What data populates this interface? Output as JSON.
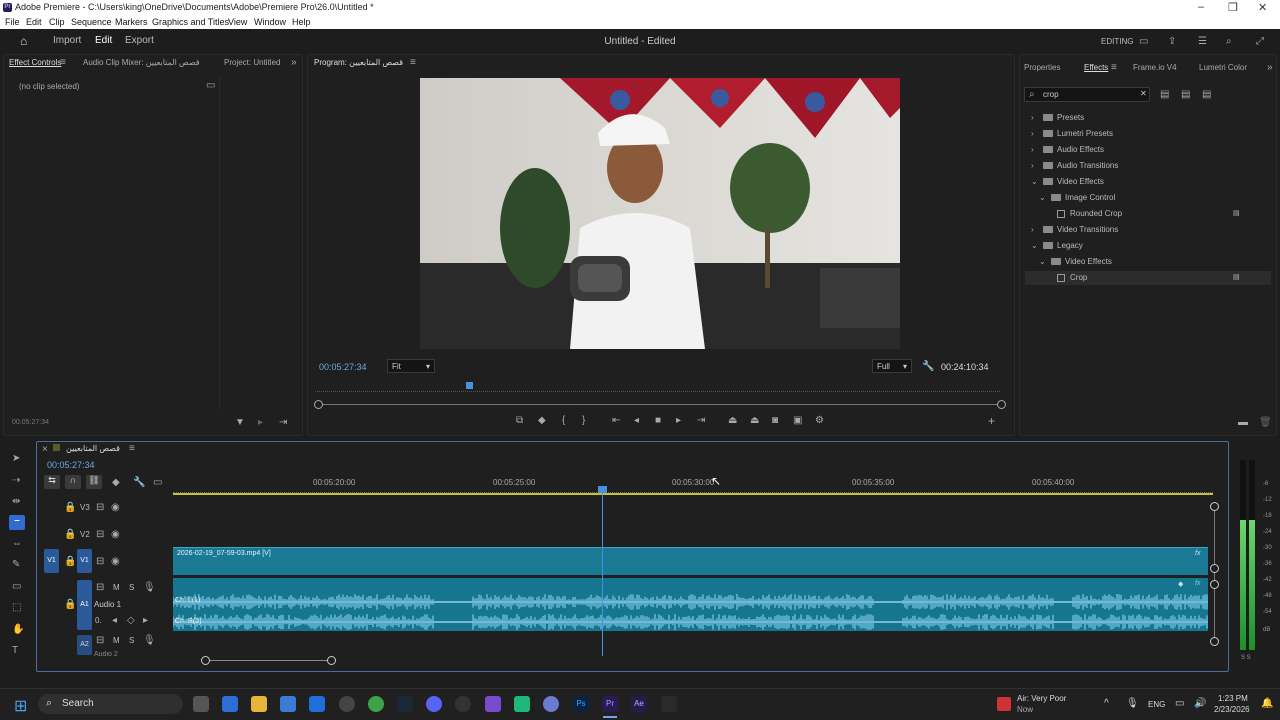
{
  "titlebar": {
    "text": "Adobe Premiere - C:\\Users\\king\\OneDrive\\Documents\\Adobe\\Premiere Pro\\26.0\\Untitled *",
    "logo": "Pr"
  },
  "menu": [
    "File",
    "Edit",
    "Clip",
    "Sequence",
    "Markers",
    "Graphics and Titles",
    "View",
    "Window",
    "Help"
  ],
  "header": {
    "import": "Import",
    "edit": "Edit",
    "export": "Export",
    "project_title": "Untitled - Edited",
    "workspace": "EDITING"
  },
  "left_panel": {
    "tab1": "Effect Controls",
    "tab2": "Audio Clip Mixer: قصص المتابعيين",
    "tab3": "Project: Untitled",
    "no_clip": "(no clip selected)",
    "timecode": "00:05:27:34"
  },
  "program": {
    "title": "Program: قصص المتابعيين",
    "timecode": "00:05:27:34",
    "fit": "Fit",
    "resolution": "Full",
    "duration": "00:24:10:34"
  },
  "effects": {
    "tab_properties": "Properties",
    "tab_effects": "Effects",
    "tab_frameio": "Frame.io V4",
    "tab_lumetri": "Lumetri Color",
    "search_value": "crop",
    "tree": [
      {
        "label": "Presets"
      },
      {
        "label": "Lumetri Presets"
      },
      {
        "label": "Audio Effects"
      },
      {
        "label": "Audio Transitions"
      },
      {
        "label": "Video Effects"
      },
      {
        "label": "Image Control"
      },
      {
        "label": "Rounded Crop"
      },
      {
        "label": "Video Transitions"
      },
      {
        "label": "Legacy"
      },
      {
        "label": "Video Effects"
      },
      {
        "label": "Crop"
      }
    ]
  },
  "timeline": {
    "sequence": "قصص المتابعيين",
    "timecode": "00:05:27:34",
    "ruler": [
      "00:05:20:00",
      "00:05:25:00",
      "00:05:30:00",
      "00:05:35:00",
      "00:05:40:00"
    ],
    "tracks": {
      "v3": "V3",
      "v2": "V2",
      "v1": "V1",
      "a1": "A1",
      "audio1": "Audio 1",
      "audio2": "Audio 2",
      "a2": "A2",
      "m": "M",
      "s": "S",
      "vol": "0."
    },
    "video_clip": "2026-02-19_07-59-03.mp4 [V]",
    "ch_l": "Ch. L(1)",
    "ch_r": "Ch. R(2)",
    "fx": "fx"
  },
  "meter": {
    "labels": [
      "-6",
      "-12",
      "-18",
      "-24",
      "-30",
      "-36",
      "-42",
      "-48",
      "-54",
      "dB"
    ],
    "bottom": "S S"
  },
  "taskbar": {
    "search": "Search",
    "weather_title": "Air: Very Poor",
    "weather_sub": "Now",
    "lang": "ENG",
    "time": "1:23 PM",
    "date": "2/23/2026"
  },
  "colors": {
    "accent": "#6ea7e6",
    "clip": "#1a7a95",
    "audio_wave": "#7cc8e8"
  }
}
